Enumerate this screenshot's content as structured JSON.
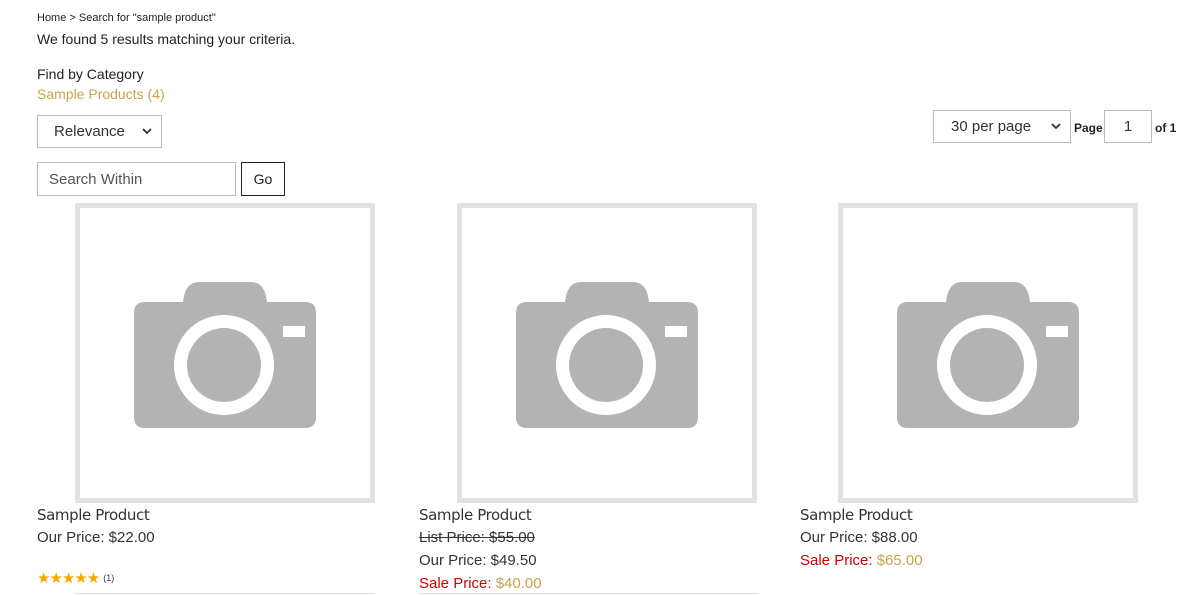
{
  "breadcrumb": {
    "home": "Home",
    "separator": ">",
    "current": "Search for \"sample product\""
  },
  "results_text": "We found 5 results matching your criteria.",
  "category": {
    "heading": "Find by Category",
    "link": "Sample Products (4)"
  },
  "sort": {
    "selected": "Relevance"
  },
  "pagination": {
    "per_page": "30 per page",
    "page_label": "Page",
    "page_value": "1",
    "of_label": "of 1"
  },
  "search_within": {
    "placeholder": "Search Within",
    "go_label": "Go"
  },
  "colors": {
    "accent_gold": "#c9a24a",
    "sale_red": "#d00000",
    "star": "#f5a800"
  },
  "products": [
    {
      "name": "Sample Product",
      "our_price": "Our Price: $22.00",
      "stars": "★★★★★",
      "rating_count": "(1)",
      "image_icon": "camera-placeholder-icon"
    },
    {
      "name": "Sample Product",
      "list_price": "List Price: $55.00",
      "our_price": "Our Price: $49.50",
      "sale_label": "Sale Price:",
      "sale_value": " $40.00",
      "image_icon": "camera-placeholder-icon"
    },
    {
      "name": "Sample Product",
      "our_price": "Our Price: $88.00",
      "sale_label": "Sale Price:",
      "sale_value": " $65.00",
      "image_icon": "camera-placeholder-icon"
    }
  ]
}
